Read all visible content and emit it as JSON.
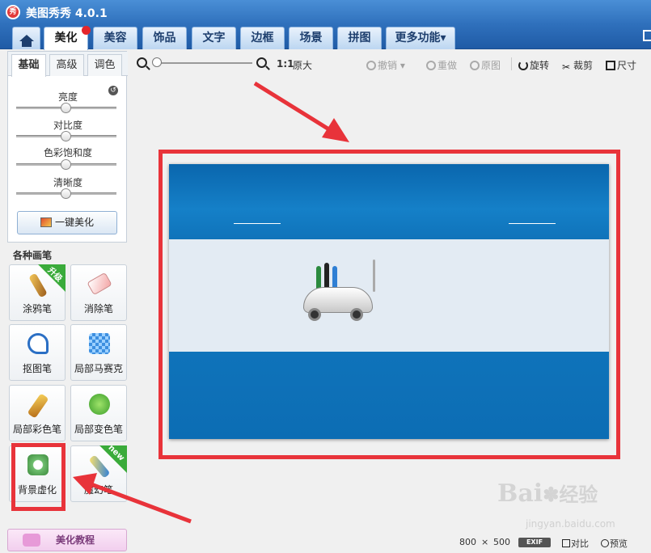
{
  "app": {
    "logo_text": "秀",
    "title": "美图秀秀 4.0.1"
  },
  "nav": {
    "tabs": [
      {
        "label": "美化",
        "active": true
      },
      {
        "label": "美容"
      },
      {
        "label": "饰品"
      },
      {
        "label": "文字"
      },
      {
        "label": "边框"
      },
      {
        "label": "场景"
      },
      {
        "label": "拼图"
      },
      {
        "label": "更多功能▾"
      }
    ]
  },
  "left_panel": {
    "subtabs": [
      "基础",
      "高级",
      "调色"
    ],
    "sliders": [
      {
        "label": "亮度",
        "level": 0.5
      },
      {
        "label": "对比度",
        "level": 0.5
      },
      {
        "label": "色彩饱和度",
        "level": 0.5
      },
      {
        "label": "清晰度",
        "level": 0.5
      }
    ],
    "one_key_label": "一键美化",
    "brush_section_title": "各种画笔",
    "brushes": [
      {
        "label": "涂鸦笔",
        "badge": "升级"
      },
      {
        "label": "消除笔",
        "badge": ""
      },
      {
        "label": "抠图笔",
        "badge": ""
      },
      {
        "label": "局部马赛克",
        "badge": ""
      },
      {
        "label": "局部彩色笔",
        "badge": ""
      },
      {
        "label": "局部变色笔",
        "badge": ""
      },
      {
        "label": "背景虚化",
        "badge": ""
      },
      {
        "label": "魔幻笔",
        "badge": "new"
      }
    ],
    "tutorial_label": "美化教程"
  },
  "toolbar": {
    "ratio_label": "1:1",
    "original_size": "原大",
    "undo": "撤销",
    "redo": "重做",
    "original": "原图",
    "rotate": "旋转",
    "crop": "裁剪",
    "size": "尺寸"
  },
  "status": {
    "width": "800",
    "times": "×",
    "height": "500",
    "exif": "EXIF",
    "compare": "对比",
    "preview": "预览"
  },
  "watermark": {
    "brand": "Bai",
    "brand2": "经验",
    "url": "jingyan.baidu.com"
  },
  "colors": {
    "accent": "#2f70bc",
    "highlight_red": "#e8333a",
    "photo_blue": "#0b6fb8"
  }
}
